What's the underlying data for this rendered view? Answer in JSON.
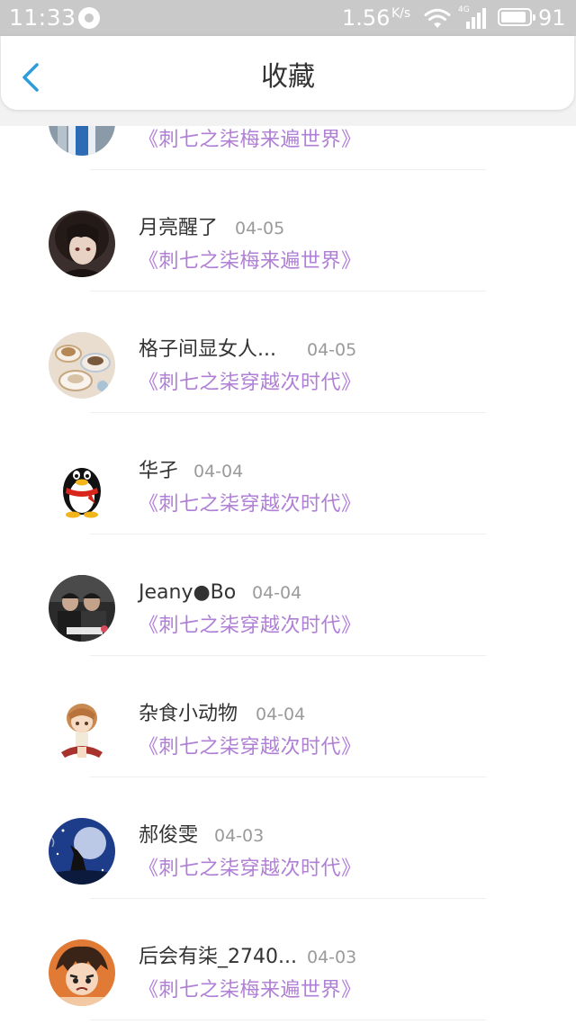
{
  "status_bar": {
    "time": "11:33",
    "speed": "1.56",
    "speed_unit": "K/s",
    "network": "4G",
    "battery_level": "91",
    "battery_fraction": 0.91
  },
  "header": {
    "back_icon": "chevron-left-icon",
    "title": "收藏"
  },
  "colors": {
    "accent": "#2d9cdb",
    "post_title": "#b07fd6",
    "status_bar": "#c9c9c9"
  },
  "items": [
    {
      "name": "",
      "date": "",
      "title": "《刺七之柒梅来遍世界》",
      "avatar": "person-avatar-1"
    },
    {
      "name": "月亮醒了",
      "date": "04-05",
      "title": "《刺七之柒梅来遍世界》",
      "avatar": "anime-girl-avatar"
    },
    {
      "name": "格子间显女人...",
      "date": "04-05",
      "title": "《刺七之柒穿越次时代》",
      "avatar": "tea-cups-avatar"
    },
    {
      "name": "华孑",
      "date": "04-04",
      "title": "《刺七之柒穿越次时代》",
      "avatar": "qq-penguin-avatar"
    },
    {
      "name": "Jeany●Bo",
      "date": "04-04",
      "title": "《刺七之柒穿越次时代》",
      "avatar": "group-photo-avatar"
    },
    {
      "name": "杂食小动物",
      "date": "04-04",
      "title": "《刺七之柒穿越次时代》",
      "avatar": "chibi-girl-avatar"
    },
    {
      "name": "郝俊雯",
      "date": "04-03",
      "title": "《刺七之柒穿越次时代》",
      "avatar": "wolf-moon-avatar"
    },
    {
      "name": "后会有柒_2740...",
      "date": "04-03",
      "title": "《刺七之柒梅来遍世界》",
      "avatar": "anime-boy-avatar"
    }
  ]
}
